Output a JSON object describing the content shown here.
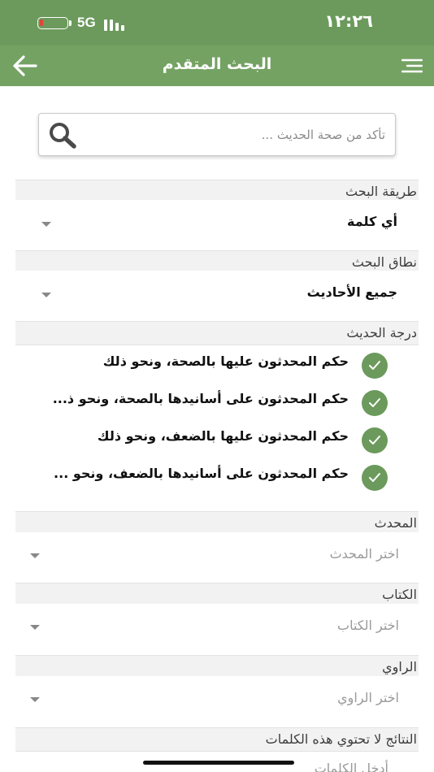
{
  "status_bar": {
    "network": "5G",
    "time": "١٢:٢٦",
    "battery_icon": "battery-low-icon",
    "signal_icon": "signal-bars-icon"
  },
  "app_bar": {
    "title": "البحث المتقدم",
    "back_icon": "arrow-left-icon",
    "menu_icon": "hamburger-menu-icon",
    "color": "#74a263"
  },
  "search": {
    "placeholder": "تأكد من صحة الحديث ...",
    "value": "",
    "icon": "search-icon"
  },
  "search_method": {
    "header": "طريقة البحث",
    "value": "أي كلمة"
  },
  "search_scope": {
    "header": "نطاق البحث",
    "value": "جميع الأحاديث"
  },
  "hadith_grade": {
    "header": "درجة الحديث",
    "options": [
      {
        "label": "حكم المحدثون عليها بالصحة، ونحو ذلك",
        "checked": true
      },
      {
        "label": "حكم المحدثون على أسانيدها بالصحة، ونحو ذ...",
        "checked": true
      },
      {
        "label": "حكم المحدثون عليها بالضعف، ونحو ذلك",
        "checked": true
      },
      {
        "label": "حكم المحدثون على أسانيدها بالضعف، ونحو ...",
        "checked": true
      }
    ]
  },
  "muhaddith": {
    "header": "المحدث",
    "placeholder": "اختر المحدث"
  },
  "book": {
    "header": "الكتاب",
    "placeholder": "اختر الكتاب"
  },
  "narrator": {
    "header": "الراوي",
    "placeholder": "اختر الراوي"
  },
  "exclude_words": {
    "header": "النتائج لا تحتوي هذه الكلمات",
    "placeholder": "أدخل الكلمات"
  },
  "colors": {
    "accent": "#6b9a5c",
    "section_bg": "#f2f2f2"
  }
}
